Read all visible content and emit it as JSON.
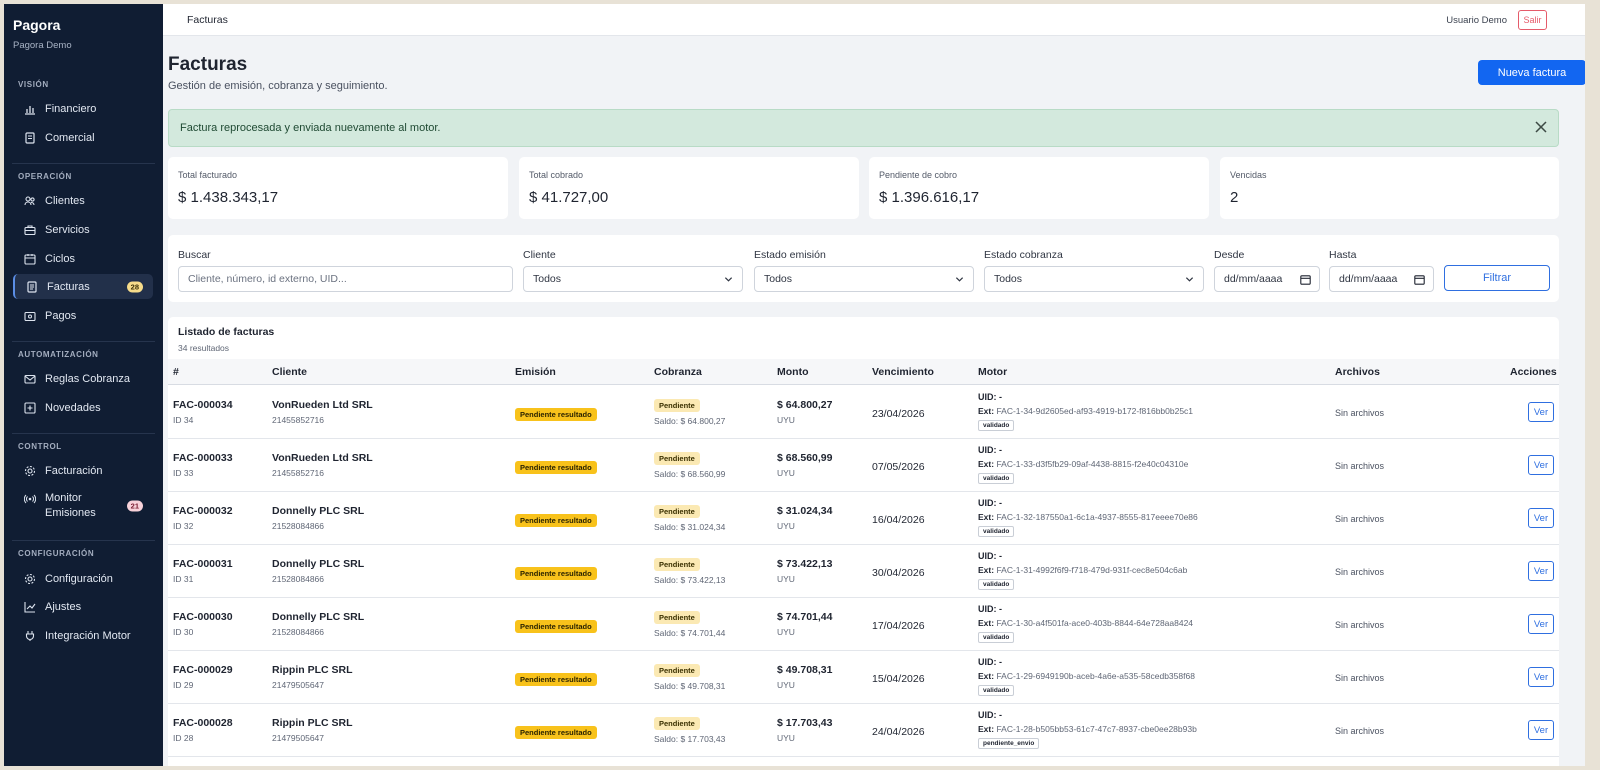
{
  "app": {
    "name": "Pagora",
    "subtitle": "Pagora Demo"
  },
  "sidebar": {
    "sections": [
      {
        "title": "VISIÓN",
        "items": [
          {
            "label": "Financiero",
            "icon": "bar-chart-icon"
          },
          {
            "label": "Comercial",
            "icon": "receipt-icon"
          }
        ]
      },
      {
        "title": "OPERACIÓN",
        "items": [
          {
            "label": "Clientes",
            "icon": "users-icon"
          },
          {
            "label": "Servicios",
            "icon": "briefcase-icon"
          },
          {
            "label": "Ciclos",
            "icon": "calendar-icon"
          },
          {
            "label": "Facturas",
            "icon": "invoice-icon",
            "badge": "28",
            "active": true
          },
          {
            "label": "Pagos",
            "icon": "wallet-icon"
          }
        ]
      },
      {
        "title": "AUTOMATIZACIÓN",
        "items": [
          {
            "label": "Reglas Cobranza",
            "icon": "mail-icon"
          },
          {
            "label": "Novedades",
            "icon": "plus-square-icon"
          }
        ]
      },
      {
        "title": "CONTROL",
        "items": [
          {
            "label": "Facturación",
            "icon": "gear-icon"
          },
          {
            "label": "Monitor Emisiones",
            "icon": "broadcast-icon",
            "badge": "21"
          }
        ]
      },
      {
        "title": "CONFIGURACIÓN",
        "items": [
          {
            "label": "Configuración",
            "icon": "gear-icon"
          },
          {
            "label": "Ajustes",
            "icon": "trend-icon"
          },
          {
            "label": "Integración Motor",
            "icon": "plug-icon"
          }
        ]
      }
    ]
  },
  "topbar": {
    "breadcrumb": "Facturas",
    "user": "Usuario Demo",
    "logout": "Salir"
  },
  "header": {
    "title": "Facturas",
    "subtitle": "Gestión de emisión, cobranza y seguimiento.",
    "new_button": "Nueva factura"
  },
  "alert": {
    "message": "Factura reprocesada y enviada nuevamente al motor."
  },
  "stats": [
    {
      "label": "Total facturado",
      "value": "$ 1.438.343,17"
    },
    {
      "label": "Total cobrado",
      "value": "$ 41.727,00"
    },
    {
      "label": "Pendiente de cobro",
      "value": "$ 1.396.616,17"
    },
    {
      "label": "Vencidas",
      "value": "2"
    }
  ],
  "filters": {
    "search_label": "Buscar",
    "search_placeholder": "Cliente, número, id externo, UID...",
    "client_label": "Cliente",
    "client_value": "Todos",
    "emission_label": "Estado emisión",
    "emission_value": "Todos",
    "collection_label": "Estado cobranza",
    "collection_value": "Todos",
    "from_label": "Desde",
    "from_value": "dd/mm/aaaa",
    "to_label": "Hasta",
    "to_value": "dd/mm/aaaa",
    "button": "Filtrar"
  },
  "list": {
    "title": "Listado de facturas",
    "count": "34 resultados",
    "columns": [
      "#",
      "Cliente",
      "Emisión",
      "Cobranza",
      "Monto",
      "Vencimiento",
      "Motor",
      "Archivos",
      "Acciones"
    ],
    "rows": [
      {
        "number": "FAC-000034",
        "id": "ID 34",
        "client": "VonRueden Ltd SRL",
        "tax_id": "21455852716",
        "emission": "Pendiente resultado",
        "collection": "Pendiente",
        "balance": "Saldo: $ 64.800,27",
        "amount": "$ 64.800,27",
        "currency": "UYU",
        "due": "23/04/2026",
        "uid": "UID: -",
        "ext_label": "Ext:",
        "ext": "FAC-1-34-9d2605ed-af93-4919-b172-f816bb0b25c1",
        "motor_tag": "validado",
        "files": "Sin archivos",
        "action": "Ver"
      },
      {
        "number": "FAC-000033",
        "id": "ID 33",
        "client": "VonRueden Ltd SRL",
        "tax_id": "21455852716",
        "emission": "Pendiente resultado",
        "collection": "Pendiente",
        "balance": "Saldo: $ 68.560,99",
        "amount": "$ 68.560,99",
        "currency": "UYU",
        "due": "07/05/2026",
        "uid": "UID: -",
        "ext_label": "Ext:",
        "ext": "FAC-1-33-d3f5fb29-09af-4438-8815-f2e40c04310e",
        "motor_tag": "validado",
        "files": "Sin archivos",
        "action": "Ver"
      },
      {
        "number": "FAC-000032",
        "id": "ID 32",
        "client": "Donnelly PLC SRL",
        "tax_id": "21528084866",
        "emission": "Pendiente resultado",
        "collection": "Pendiente",
        "balance": "Saldo: $ 31.024,34",
        "amount": "$ 31.024,34",
        "currency": "UYU",
        "due": "16/04/2026",
        "uid": "UID: -",
        "ext_label": "Ext:",
        "ext": "FAC-1-32-187550a1-6c1a-4937-8555-817eeee70e86",
        "motor_tag": "validado",
        "files": "Sin archivos",
        "action": "Ver"
      },
      {
        "number": "FAC-000031",
        "id": "ID 31",
        "client": "Donnelly PLC SRL",
        "tax_id": "21528084866",
        "emission": "Pendiente resultado",
        "collection": "Pendiente",
        "balance": "Saldo: $ 73.422,13",
        "amount": "$ 73.422,13",
        "currency": "UYU",
        "due": "30/04/2026",
        "uid": "UID: -",
        "ext_label": "Ext:",
        "ext": "FAC-1-31-4992f6f9-f718-479d-931f-cec8e504c6ab",
        "motor_tag": "validado",
        "files": "Sin archivos",
        "action": "Ver"
      },
      {
        "number": "FAC-000030",
        "id": "ID 30",
        "client": "Donnelly PLC SRL",
        "tax_id": "21528084866",
        "emission": "Pendiente resultado",
        "collection": "Pendiente",
        "balance": "Saldo: $ 74.701,44",
        "amount": "$ 74.701,44",
        "currency": "UYU",
        "due": "17/04/2026",
        "uid": "UID: -",
        "ext_label": "Ext:",
        "ext": "FAC-1-30-a4f501fa-ace0-403b-8844-64e728aa8424",
        "motor_tag": "validado",
        "files": "Sin archivos",
        "action": "Ver"
      },
      {
        "number": "FAC-000029",
        "id": "ID 29",
        "client": "Rippin PLC SRL",
        "tax_id": "21479505647",
        "emission": "Pendiente resultado",
        "collection": "Pendiente",
        "balance": "Saldo: $ 49.708,31",
        "amount": "$ 49.708,31",
        "currency": "UYU",
        "due": "15/04/2026",
        "uid": "UID: -",
        "ext_label": "Ext:",
        "ext": "FAC-1-29-6949190b-aceb-4a6e-a535-58cedb358f68",
        "motor_tag": "validado",
        "files": "Sin archivos",
        "action": "Ver"
      },
      {
        "number": "FAC-000028",
        "id": "ID 28",
        "client": "Rippin PLC SRL",
        "tax_id": "21479505647",
        "emission": "Pendiente resultado",
        "collection": "Pendiente",
        "balance": "Saldo: $ 17.703,43",
        "amount": "$ 17.703,43",
        "currency": "UYU",
        "due": "24/04/2026",
        "uid": "UID: -",
        "ext_label": "Ext:",
        "ext": "FAC-1-28-b505bb53-61c7-47c7-8937-cbe0ee28b93b",
        "motor_tag": "pendiente_envio",
        "files": "Sin archivos",
        "action": "Ver"
      }
    ]
  }
}
